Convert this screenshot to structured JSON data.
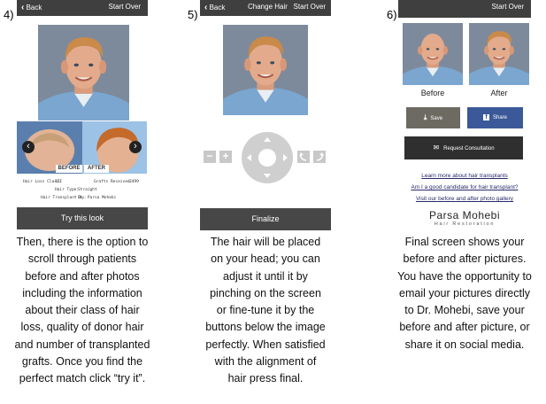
{
  "panel4": {
    "step": "4)",
    "header": {
      "back": "Back",
      "start_over": "Start Over"
    },
    "compare": {
      "before": "BEFORE",
      "after": "AFTER"
    },
    "info": {
      "hair_loss_label": "Hair Loss Class:",
      "hair_loss_value": "III",
      "grafts_label": "Grafts Received:",
      "grafts_value": "2499",
      "hair_type_label": "Hair Type:",
      "hair_type_value": "Straight",
      "transplant_label": "Hair Transplant By:",
      "transplant_value": "Dr. Parsa Mohebi"
    },
    "try_button": "Try this look",
    "caption": [
      "Then, there is the option to",
      "scroll through patients",
      "before and after photos",
      "including the information",
      "about their class of hair",
      "loss, quality of donor hair",
      "and number of transplanted",
      "grafts.  Once you find the",
      "perfect match click “try it”."
    ]
  },
  "panel5": {
    "step": "5)",
    "header": {
      "back": "Back",
      "change_hair": "Change Hair",
      "start_over": "Start Over"
    },
    "controls": {
      "minus": "−",
      "plus": "+"
    },
    "finalize_button": "Finalize",
    "caption": [
      "The hair will be placed",
      "on your head; you can",
      "adjust it until it by",
      "pinching on the screen",
      "or fine-tune it by the",
      "buttons below the image",
      "perfectly. When satisfied",
      "with the alignment of",
      "hair press final."
    ]
  },
  "panel6": {
    "step": "6)",
    "header": {
      "start_over": "Start Over"
    },
    "before_label": "Before",
    "after_label": "After",
    "save_button": "Save",
    "share_button": "Share",
    "request_button": "Request Consultation",
    "links": [
      "Learn more about hair transplants",
      "Am I a good candidate for hair transplant?",
      "Visit our before and after photo gallery"
    ],
    "logo_name": "Parsa Mohebi",
    "logo_sub": "Hair Restoration",
    "caption": [
      "Final screen shows your",
      "before and after pictures.",
      "You have the opportunity to",
      "email your pictures directly",
      "to Dr. Mohebi, save your",
      "before and after picture, or",
      "share it on social media."
    ]
  },
  "colors": {
    "bar": "#3f3f3f",
    "facebook": "#3b5998",
    "save": "#6d6a62",
    "request": "#2f2f2f",
    "photo_bg": "#6f7f93"
  }
}
